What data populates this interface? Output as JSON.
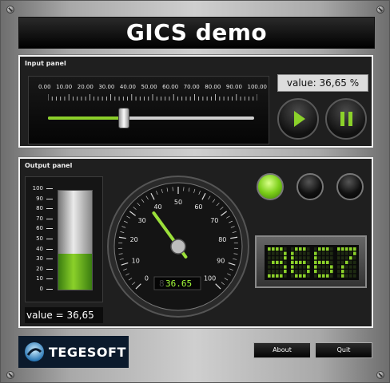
{
  "title": "GICS demo",
  "input_panel": {
    "label": "Input panel",
    "scale_labels": [
      "0.00",
      "10.00",
      "20.00",
      "30.00",
      "40.00",
      "50.00",
      "60.00",
      "70.00",
      "80.00",
      "90.00",
      "100.00"
    ],
    "slider_value_fraction": 0.3665,
    "value_text": "value: 36,65 %"
  },
  "output_panel": {
    "label": "Output panel",
    "bar_scale": [
      "100",
      "90",
      "80",
      "70",
      "60",
      "50",
      "40",
      "30",
      "20",
      "10",
      "0"
    ],
    "bar_level_fraction": 0.3665,
    "bar_value_text": "value = 36,65",
    "gauge_labels": [
      "0",
      "10",
      "20",
      "30",
      "40",
      "50",
      "60",
      "70",
      "80",
      "90",
      "100"
    ],
    "gauge_value": 36.65,
    "gauge_digital_prefix": "8",
    "gauge_digital": "36.65",
    "leds": [
      "on",
      "off",
      "off"
    ],
    "matrix_text": "3667"
  },
  "footer": {
    "logo_text": "TEGESOFT",
    "about_label": "About",
    "quit_label": "Quit"
  },
  "colors": {
    "accent": "#8bd12a",
    "panel_bg": "#1f1f1f",
    "title_bg": "#000000"
  }
}
